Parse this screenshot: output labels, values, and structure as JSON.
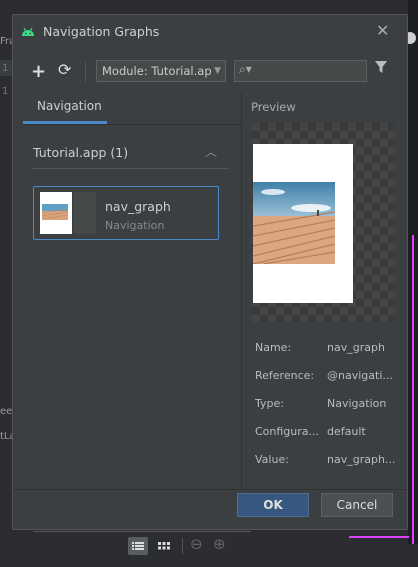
{
  "background": {
    "left_fragment": "Fra",
    "left_line1": "1",
    "left_line2": "1",
    "left_ee": "ee",
    "left_la": "tLa"
  },
  "dialog": {
    "title": "Navigation Graphs",
    "close": "✕"
  },
  "toolbar": {
    "add_icon": "plus-icon",
    "refresh_icon": "refresh-icon",
    "module_value": "Module: Tutorial.ap",
    "search_placeholder": "",
    "filter_icon": "filter-icon"
  },
  "left": {
    "tab_label": "Navigation",
    "group_header": "Tutorial.app (1)",
    "items": [
      {
        "name": "nav_graph",
        "type": "Navigation"
      }
    ]
  },
  "preview": {
    "label": "Preview",
    "properties": [
      {
        "key": "Name:",
        "value": "nav_graph"
      },
      {
        "key": "Reference:",
        "value": "@navigati..."
      },
      {
        "key": "Type:",
        "value": "Navigation"
      },
      {
        "key": "Configura...",
        "value": "default"
      },
      {
        "key": "Value:",
        "value": "nav_graph..."
      }
    ]
  },
  "footer": {
    "ok_label": "OK",
    "cancel_label": "Cancel"
  },
  "colors": {
    "accent": "#4a88c7",
    "ok_button": "#365880",
    "dialog_bg": "#3c3f41"
  }
}
